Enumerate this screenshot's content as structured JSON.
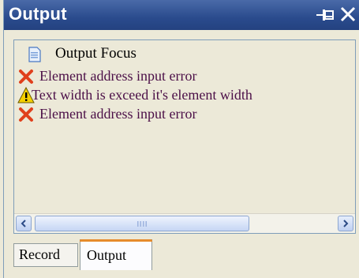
{
  "window": {
    "title": "Output"
  },
  "header": {
    "focus_label": "Output Focus",
    "icon": "document-icon"
  },
  "messages": [
    {
      "type": "error",
      "icon": "error-x-icon",
      "text": "Element address input error"
    },
    {
      "type": "warning",
      "icon": "warning-icon",
      "text": "Text width is exceed it's element width"
    },
    {
      "type": "error",
      "icon": "error-x-icon",
      "text": "Element address input error"
    }
  ],
  "tabs": [
    {
      "label": "Record",
      "active": false
    },
    {
      "label": "Output",
      "active": true
    }
  ],
  "colors": {
    "titlebar": "#2a4b8d",
    "message_text": "#4b0f47",
    "error": "#e0401c",
    "warning": "#f5d000",
    "active_tab_accent": "#e68b2c"
  }
}
